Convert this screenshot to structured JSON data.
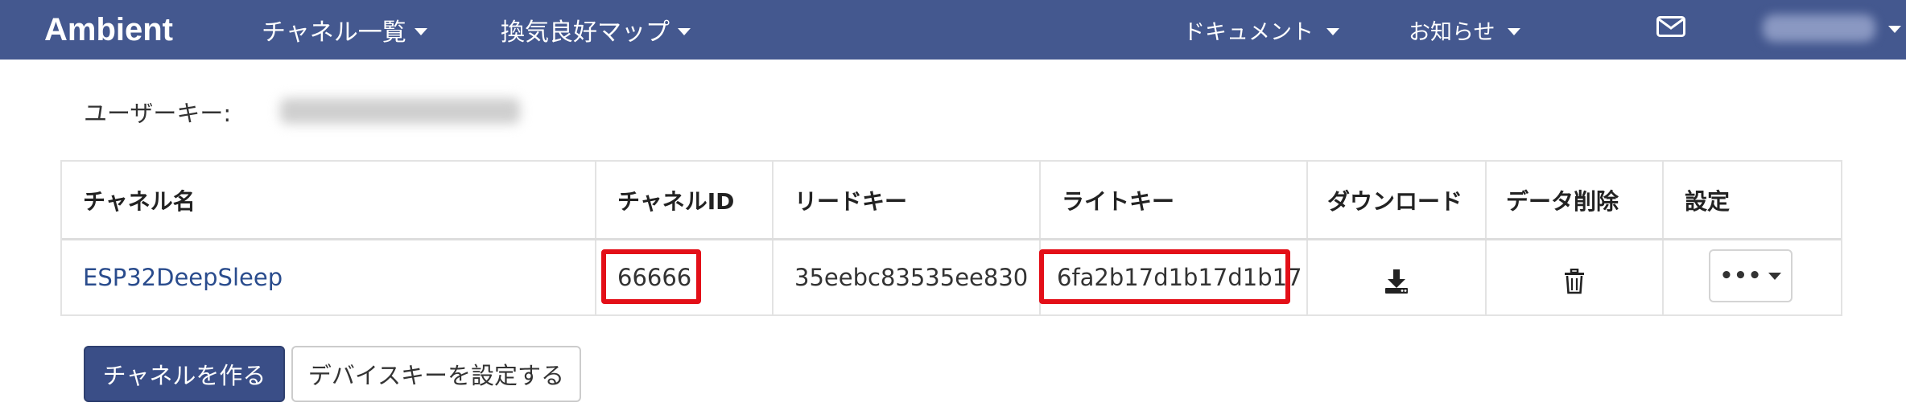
{
  "navbar": {
    "brand": "Ambient",
    "channels_menu": "チャネル一覧",
    "air_map_menu": "換気良好マップ",
    "docs_menu": "ドキュメント",
    "news_menu": "お知らせ",
    "mail_icon": "envelope-icon"
  },
  "userkey": {
    "label": "ユーザーキー:"
  },
  "table": {
    "headers": {
      "name": "チャネル名",
      "id": "チャネルID",
      "read_key": "リードキー",
      "write_key": "ライトキー",
      "download": "ダウンロード",
      "delete": "データ削除",
      "settings": "設定"
    },
    "rows": [
      {
        "name": "ESP32DeepSleep",
        "id": "66666",
        "read_key": "35eebc83535ee830",
        "write_key": "6fa2b17d1b17d1b17",
        "download_icon": "download-icon",
        "delete_icon": "trash-icon",
        "settings_label": "•••"
      }
    ]
  },
  "buttons": {
    "create_channel": "チャネルを作る",
    "set_device_key": "デバイスキーを設定する"
  },
  "colors": {
    "navbar": "#44588f",
    "link": "#2a4c8d",
    "highlight": "#e30f18",
    "primary_button": "#3a4e87"
  }
}
